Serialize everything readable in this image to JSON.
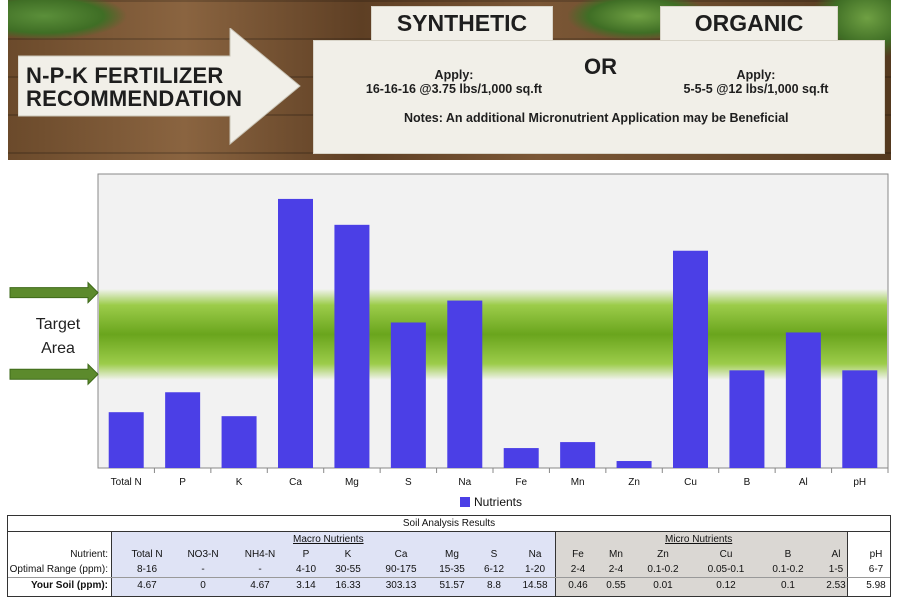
{
  "banner": {
    "title": "N-P-K FERTILIZER RECOMMENDATION",
    "synthetic_label": "SYNTHETIC",
    "organic_label": "ORGANIC",
    "or_label": "OR",
    "synthetic_apply_label": "Apply:",
    "synthetic_apply_value": "16-16-16 @3.75 lbs/1,000 sq.ft",
    "organic_apply_label": "Apply:",
    "organic_apply_value": "5-5-5 @12 lbs/1,000 sq.ft",
    "note": "Notes: An additional Micronutrient Application may be Beneficial"
  },
  "target_label_line1": "Target",
  "target_label_line2": "Area",
  "colors": {
    "bar": "#4b3fe6",
    "band": "#7fb82a",
    "arrow": "#5c8a2c",
    "macro_bg": "#dfe3f5",
    "micro_bg": "#dad7d3"
  },
  "chart_data": {
    "type": "bar",
    "categories": [
      "Total N",
      "P",
      "K",
      "Ca",
      "Mg",
      "S",
      "Na",
      "Fe",
      "Mn",
      "Zn",
      "Cu",
      "B",
      "Al",
      "pH"
    ],
    "series": [
      {
        "name": "Nutrients",
        "values": [
          56,
          76,
          52,
          270,
          244,
          146,
          168,
          20,
          26,
          7,
          218,
          98,
          136,
          98
        ]
      }
    ],
    "ylim": [
      0,
      295
    ],
    "target_band": [
      88,
      180
    ],
    "legend": "bottom",
    "grid": false,
    "xlabel": "",
    "ylabel": ""
  },
  "table": {
    "title": "Soil Analysis Results",
    "macro_label": "Macro Nutrients",
    "micro_label": "Micro Nutrients",
    "row_labels": [
      "Nutrient:",
      "Optimal Range (ppm):",
      "Your Soil (ppm):"
    ],
    "columns": [
      {
        "nutrient": "Total N",
        "range": "8-16",
        "soil": "4.67"
      },
      {
        "nutrient": "NO3-N",
        "range": "-",
        "soil": "0"
      },
      {
        "nutrient": "NH4-N",
        "range": "-",
        "soil": "4.67"
      },
      {
        "nutrient": "P",
        "range": "4-10",
        "soil": "3.14"
      },
      {
        "nutrient": "K",
        "range": "30-55",
        "soil": "16.33"
      },
      {
        "nutrient": "Ca",
        "range": "90-175",
        "soil": "303.13"
      },
      {
        "nutrient": "Mg",
        "range": "15-35",
        "soil": "51.57"
      },
      {
        "nutrient": "S",
        "range": "6-12",
        "soil": "8.8"
      },
      {
        "nutrient": "Na",
        "range": "1-20",
        "soil": "14.58"
      },
      {
        "nutrient": "Fe",
        "range": "2-4",
        "soil": "0.46"
      },
      {
        "nutrient": "Mn",
        "range": "2-4",
        "soil": "0.55"
      },
      {
        "nutrient": "Zn",
        "range": "0.1-0.2",
        "soil": "0.01"
      },
      {
        "nutrient": "Cu",
        "range": "0.05-0.1",
        "soil": "0.12"
      },
      {
        "nutrient": "B",
        "range": "0.1-0.2",
        "soil": "0.1"
      },
      {
        "nutrient": "Al",
        "range": "1-5",
        "soil": "2.53"
      },
      {
        "nutrient": "pH",
        "range": "6-7",
        "soil": "5.98"
      }
    ]
  }
}
